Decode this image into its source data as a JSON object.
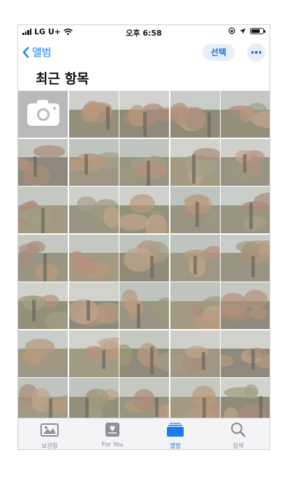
{
  "status_bar": {
    "carrier": "LG U+",
    "time": "오후 6:58"
  },
  "nav": {
    "back_label": "앨범",
    "select_label": "선택"
  },
  "page_title": "최근 항목",
  "tabs": [
    {
      "label": "보관함",
      "icon": "photo-library-icon",
      "active": false
    },
    {
      "label": "For You",
      "icon": "for-you-icon",
      "active": false
    },
    {
      "label": "앨범",
      "icon": "albums-icon",
      "active": true
    },
    {
      "label": "검색",
      "icon": "search-icon",
      "active": false
    }
  ],
  "colors": {
    "accent": "#1a7cf5",
    "inactive": "#8e8e93"
  }
}
